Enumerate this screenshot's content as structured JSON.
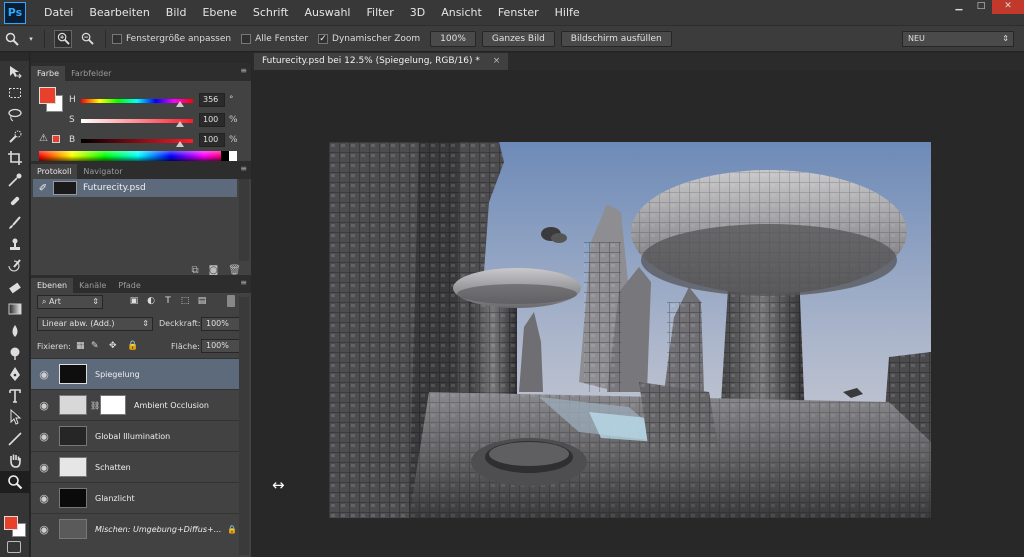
{
  "app": {
    "logo": "Ps"
  },
  "menu": [
    "Datei",
    "Bearbeiten",
    "Bild",
    "Ebene",
    "Schrift",
    "Auswahl",
    "Filter",
    "3D",
    "Ansicht",
    "Fenster",
    "Hilfe"
  ],
  "window_controls": {
    "minimize": "▁",
    "maximize": "□",
    "close": "✕"
  },
  "options_bar": {
    "tool_icon": "zoom-tool-icon",
    "fit_windows_label": "Fenstergröße anpassen",
    "fit_windows_checked": false,
    "all_windows_label": "Alle Fenster",
    "all_windows_checked": false,
    "scrubby_zoom_label": "Dynamischer Zoom",
    "scrubby_zoom_checked": true,
    "btn_100": "100%",
    "btn_whole_image": "Ganzes Bild",
    "btn_fill_screen": "Bildschirm ausfüllen",
    "workspace": "NEU"
  },
  "color_panel": {
    "tabs": [
      "Farbe",
      "Farbfelder"
    ],
    "foreground_color": "#e8412b",
    "background_color": "#ffffff",
    "sliders": [
      {
        "label": "H",
        "value": "356",
        "unit": "°"
      },
      {
        "label": "S",
        "value": "100",
        "unit": "%"
      },
      {
        "label": "B",
        "value": "100",
        "unit": "%"
      }
    ]
  },
  "history_panel": {
    "tabs": [
      "Protokoll",
      "Navigator"
    ],
    "items": [
      {
        "name": "Futurecity.psd"
      }
    ]
  },
  "layers_panel": {
    "tabs": [
      "Ebenen",
      "Kanäle",
      "Pfade"
    ],
    "filter_kind": "Art",
    "blend_mode": "Linear abw. (Add.)",
    "opacity_label": "Deckkraft:",
    "opacity": "100%",
    "lock_label": "Fixieren:",
    "fill_label": "Fläche:",
    "fill": "100%",
    "layers": [
      {
        "name": "Spiegelung",
        "selected": true,
        "italic": false,
        "mask": false
      },
      {
        "name": "Ambient Occlusion",
        "selected": false,
        "italic": false,
        "mask": true
      },
      {
        "name": "Global Illumination",
        "selected": false,
        "italic": false,
        "mask": false
      },
      {
        "name": "Schatten",
        "selected": false,
        "italic": false,
        "mask": false
      },
      {
        "name": "Glanzlicht",
        "selected": false,
        "italic": false,
        "mask": false
      },
      {
        "name": "Mischen: Umgebung+Diffus+...",
        "selected": false,
        "italic": true,
        "mask": false,
        "locked": true
      }
    ]
  },
  "document": {
    "tab_title": "Futurecity.psd bei 12.5% (Spiegelung, RGB/16) *",
    "close": "×"
  }
}
